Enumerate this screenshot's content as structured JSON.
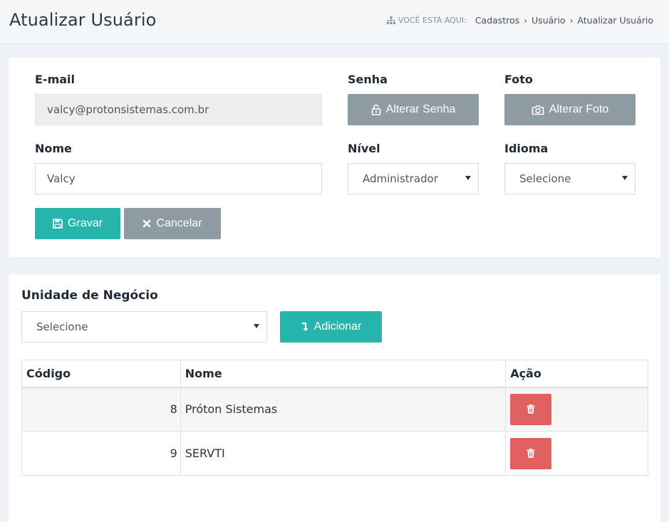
{
  "header": {
    "title": "Atualizar Usuário",
    "breadcrumb_prefix": "VOCÊ ESTÁ AQUI:",
    "breadcrumb_items": [
      "Cadastros",
      "Usuário",
      "Atualizar Usuário"
    ]
  },
  "form": {
    "email_label": "E-mail",
    "email_value": "valcy@protonsistemas.com.br",
    "senha_label": "Senha",
    "alterar_senha_label": "Alterar Senha",
    "foto_label": "Foto",
    "alterar_foto_label": "Alterar Foto",
    "nome_label": "Nome",
    "nome_value": "Valcy",
    "nivel_label": "Nível",
    "nivel_value": "Administrador",
    "idioma_label": "Idioma",
    "idioma_value": "Selecione",
    "gravar_label": "Gravar",
    "cancelar_label": "Cancelar"
  },
  "business_unit": {
    "label": "Unidade de Negócio",
    "select_value": "Selecione",
    "adicionar_label": "Adicionar",
    "columns": [
      "Código",
      "Nome",
      "Ação"
    ],
    "rows": [
      {
        "codigo": "8",
        "nome": "Próton Sistemas"
      },
      {
        "codigo": "9",
        "nome": "SERVTI"
      }
    ]
  },
  "colors": {
    "teal": "#26b4ad",
    "gray_button": "#8f9ba3",
    "danger": "#e0615f"
  }
}
